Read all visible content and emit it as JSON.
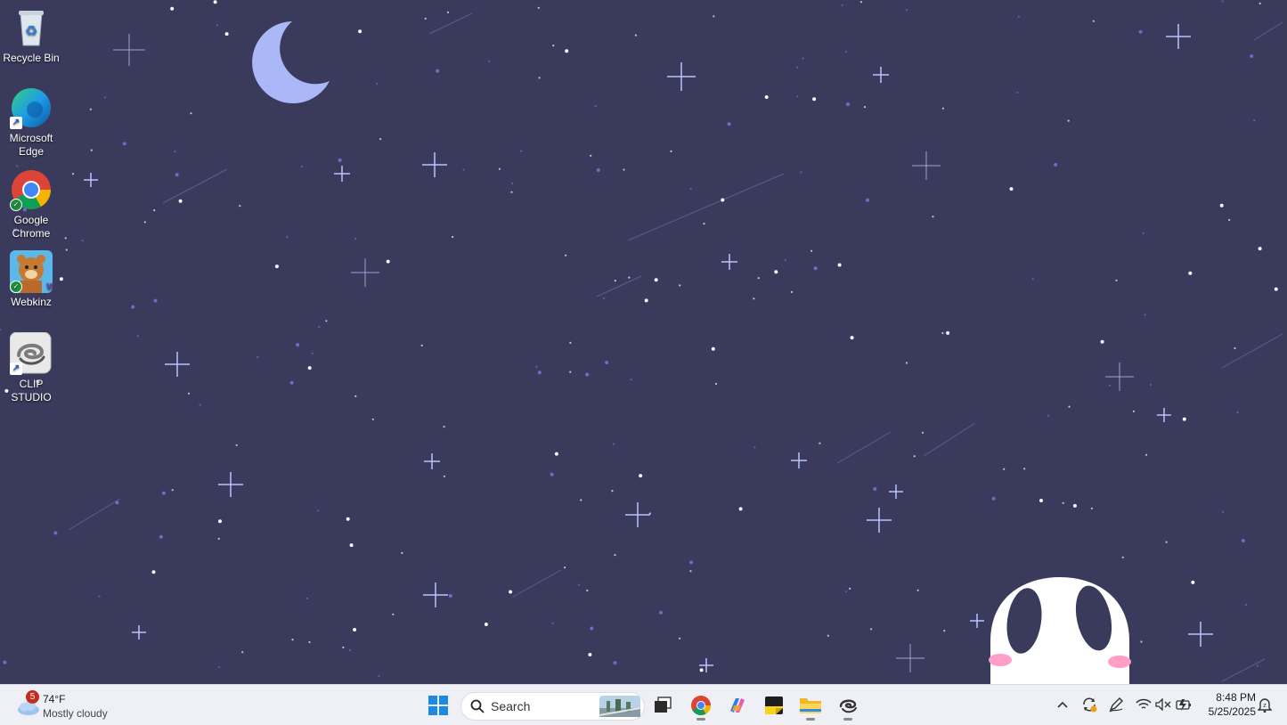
{
  "desktop": {
    "icons": [
      {
        "label": "Recycle Bin",
        "icon": "recycle-bin-icon"
      },
      {
        "label": "Microsoft Edge",
        "icon": "edge-icon"
      },
      {
        "label": "Google Chrome",
        "icon": "chrome-icon"
      },
      {
        "label": "Webkinz",
        "icon": "webkinz-icon"
      },
      {
        "label": "CLIP STUDIO",
        "icon": "clip-studio-icon"
      }
    ],
    "wallpaper": {
      "background": "#3a3a5c",
      "moon_color": "#aab8f8",
      "star_color": "#b9c3ff",
      "ghost_color": "#ffffff",
      "blush_color": "#ff9ec8"
    }
  },
  "taskbar": {
    "weather": {
      "badge": "5",
      "temp": "74°F",
      "condition": "Mostly cloudy",
      "icon": "cloud-icon"
    },
    "search": {
      "placeholder": "Search"
    },
    "pinned": [
      {
        "name": "start",
        "icon": "windows-start-icon"
      },
      {
        "name": "task-view",
        "icon": "task-view-icon"
      },
      {
        "name": "chrome",
        "icon": "chrome-icon",
        "running": true
      },
      {
        "name": "copilot",
        "icon": "copilot-icon"
      },
      {
        "name": "sticky-notes",
        "icon": "sticky-notes-icon"
      },
      {
        "name": "file-explorer",
        "icon": "folder-icon",
        "running": true
      },
      {
        "name": "clip-studio",
        "icon": "clip-studio-icon",
        "running": true
      }
    ],
    "tray": [
      "chevron-up-icon",
      "sync-icon",
      "pen-icon",
      "wifi-icon",
      "volume-muted-icon",
      "battery-charging-icon"
    ],
    "clock": {
      "time": "8:48 PM",
      "date": "5/25/2025"
    },
    "notification_icon": "notification-bell-icon"
  }
}
